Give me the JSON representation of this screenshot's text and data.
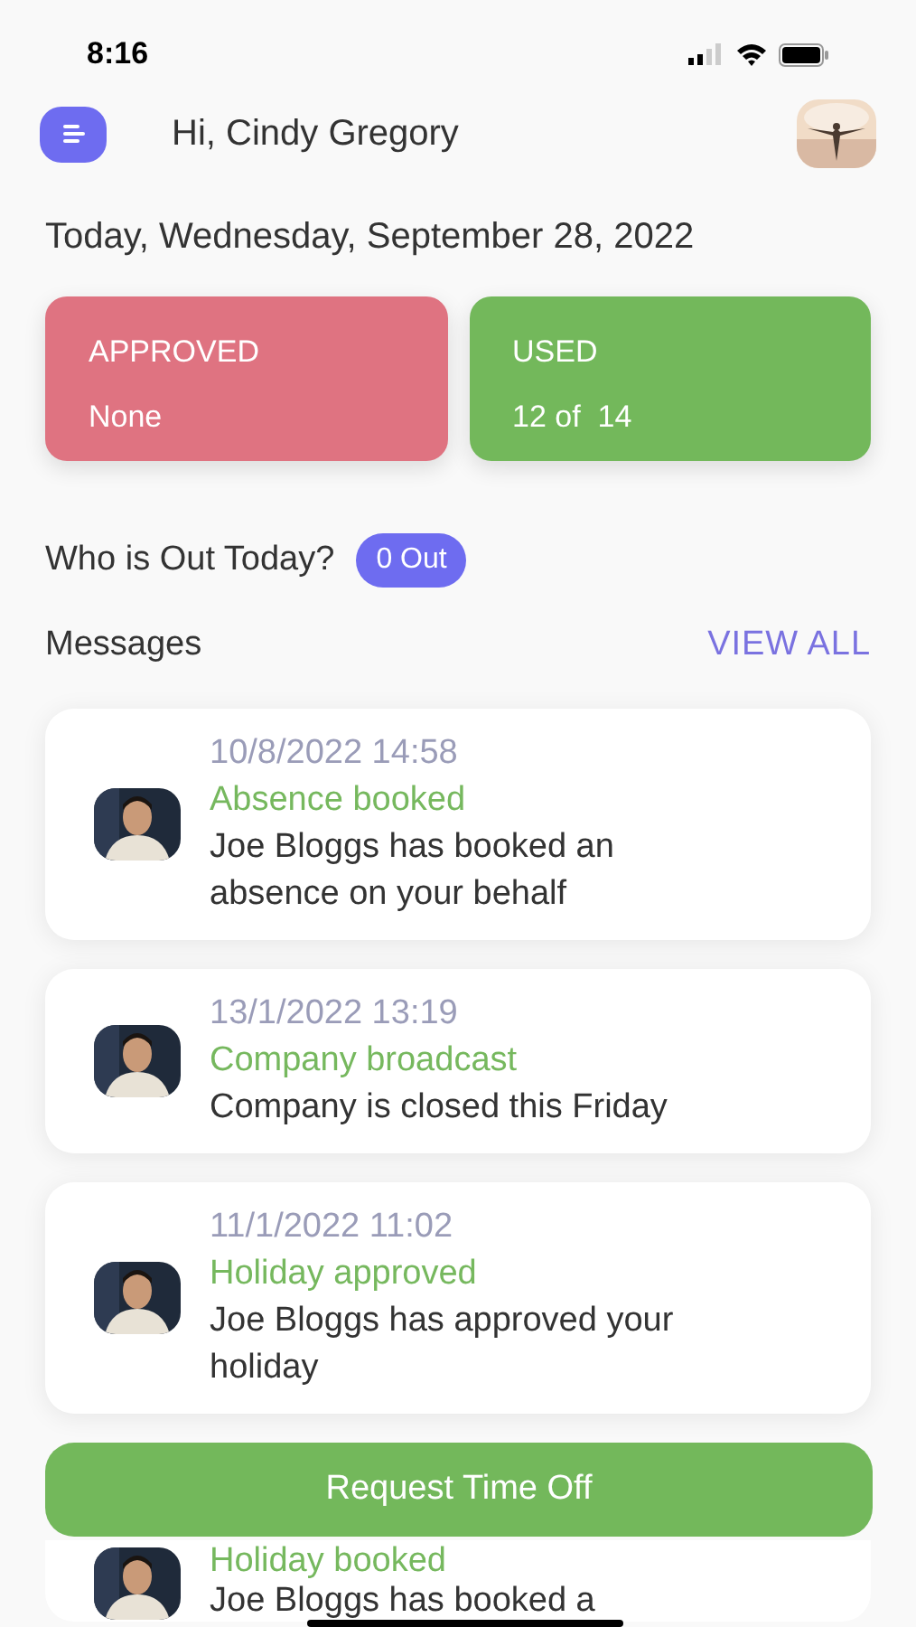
{
  "status_bar": {
    "time": "8:16"
  },
  "header": {
    "greeting": "Hi, Cindy Gregory"
  },
  "date_line": "Today, Wednesday, September 28, 2022",
  "stats": [
    {
      "kind": "approved",
      "label": "APPROVED",
      "value": "None"
    },
    {
      "kind": "used",
      "label": "USED",
      "value": "12 of  14"
    }
  ],
  "out_today": {
    "label": "Who is Out Today?",
    "badge": "0 Out"
  },
  "messages": {
    "title": "Messages",
    "view_all": "VIEW ALL",
    "items": [
      {
        "date": "10/8/2022 14:58",
        "title": "Absence booked",
        "body": "Joe Bloggs has booked an absence on your behalf"
      },
      {
        "date": "13/1/2022 13:19",
        "title": "Company broadcast",
        "body": "Company is closed this Friday"
      },
      {
        "date": "11/1/2022 11:02",
        "title": "Holiday approved",
        "body": "Joe Bloggs has approved your holiday"
      },
      {
        "title": "Holiday booked",
        "body": "Joe Bloggs has booked a"
      }
    ]
  },
  "request_button": "Request Time Off"
}
